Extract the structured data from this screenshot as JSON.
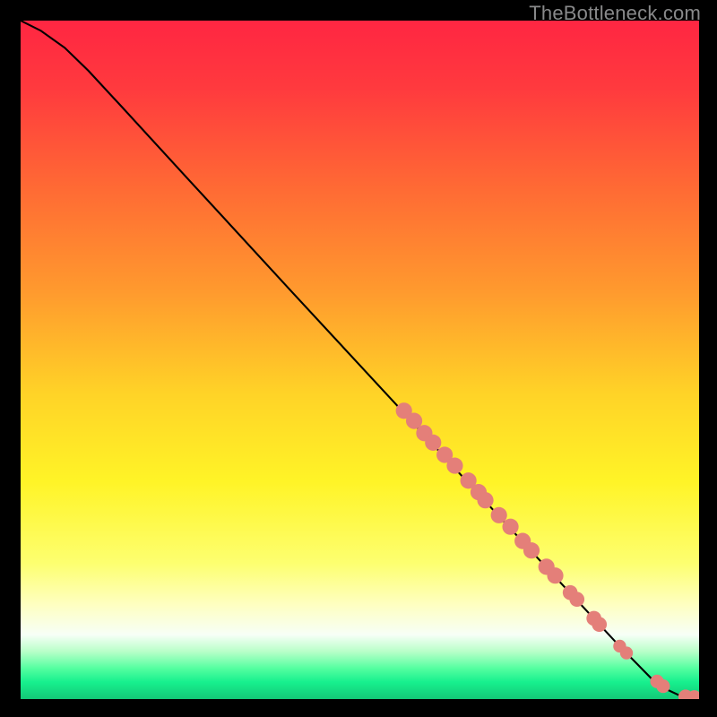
{
  "watermark": "TheBottleneck.com",
  "colors": {
    "background": "#000000",
    "curve": "#000000",
    "marker": "#e47f79",
    "gradient_stops": [
      {
        "offset": 0.0,
        "color": "#ff2642"
      },
      {
        "offset": 0.1,
        "color": "#ff3a3e"
      },
      {
        "offset": 0.25,
        "color": "#ff6b34"
      },
      {
        "offset": 0.4,
        "color": "#ff9a2e"
      },
      {
        "offset": 0.55,
        "color": "#ffd327"
      },
      {
        "offset": 0.68,
        "color": "#fff427"
      },
      {
        "offset": 0.8,
        "color": "#fdff70"
      },
      {
        "offset": 0.86,
        "color": "#feffc0"
      },
      {
        "offset": 0.905,
        "color": "#f7fff7"
      },
      {
        "offset": 0.93,
        "color": "#b8ffc8"
      },
      {
        "offset": 0.955,
        "color": "#53ffa0"
      },
      {
        "offset": 0.975,
        "color": "#17f08e"
      },
      {
        "offset": 1.0,
        "color": "#13c877"
      }
    ]
  },
  "chart_data": {
    "type": "line",
    "title": "",
    "xlabel": "",
    "ylabel": "",
    "xlim": [
      0,
      100
    ],
    "ylim": [
      0,
      100
    ],
    "curve": [
      {
        "x": 0.0,
        "y": 100.0
      },
      {
        "x": 3.0,
        "y": 98.5
      },
      {
        "x": 6.5,
        "y": 96.0
      },
      {
        "x": 10.0,
        "y": 92.6
      },
      {
        "x": 15.0,
        "y": 87.2
      },
      {
        "x": 25.0,
        "y": 76.3
      },
      {
        "x": 40.0,
        "y": 60.0
      },
      {
        "x": 55.0,
        "y": 43.8
      },
      {
        "x": 70.0,
        "y": 27.5
      },
      {
        "x": 80.0,
        "y": 16.7
      },
      {
        "x": 88.0,
        "y": 8.1
      },
      {
        "x": 93.0,
        "y": 3.0
      },
      {
        "x": 95.5,
        "y": 1.3
      },
      {
        "x": 97.3,
        "y": 0.45
      },
      {
        "x": 100.0,
        "y": 0.2
      }
    ],
    "markers": [
      {
        "x": 56.5,
        "y": 42.5,
        "r": 1.2
      },
      {
        "x": 58.0,
        "y": 41.0,
        "r": 1.2
      },
      {
        "x": 59.5,
        "y": 39.2,
        "r": 1.2
      },
      {
        "x": 60.8,
        "y": 37.8,
        "r": 1.2
      },
      {
        "x": 62.5,
        "y": 36.0,
        "r": 1.2
      },
      {
        "x": 64.0,
        "y": 34.4,
        "r": 1.2
      },
      {
        "x": 66.0,
        "y": 32.2,
        "r": 1.2
      },
      {
        "x": 67.5,
        "y": 30.5,
        "r": 1.2
      },
      {
        "x": 68.5,
        "y": 29.3,
        "r": 1.2
      },
      {
        "x": 70.5,
        "y": 27.1,
        "r": 1.2
      },
      {
        "x": 72.2,
        "y": 25.4,
        "r": 1.2
      },
      {
        "x": 74.0,
        "y": 23.3,
        "r": 1.2
      },
      {
        "x": 75.3,
        "y": 21.9,
        "r": 1.2
      },
      {
        "x": 77.5,
        "y": 19.5,
        "r": 1.2
      },
      {
        "x": 78.8,
        "y": 18.2,
        "r": 1.2
      },
      {
        "x": 81.0,
        "y": 15.7,
        "r": 1.1
      },
      {
        "x": 82.0,
        "y": 14.7,
        "r": 1.1
      },
      {
        "x": 84.5,
        "y": 11.9,
        "r": 1.1
      },
      {
        "x": 85.3,
        "y": 11.0,
        "r": 1.1
      },
      {
        "x": 88.3,
        "y": 7.8,
        "r": 0.95
      },
      {
        "x": 89.3,
        "y": 6.8,
        "r": 0.95
      },
      {
        "x": 93.8,
        "y": 2.6,
        "r": 1.0
      },
      {
        "x": 94.7,
        "y": 1.9,
        "r": 1.0
      },
      {
        "x": 98.0,
        "y": 0.35,
        "r": 1.05
      },
      {
        "x": 99.3,
        "y": 0.25,
        "r": 1.05
      }
    ]
  }
}
